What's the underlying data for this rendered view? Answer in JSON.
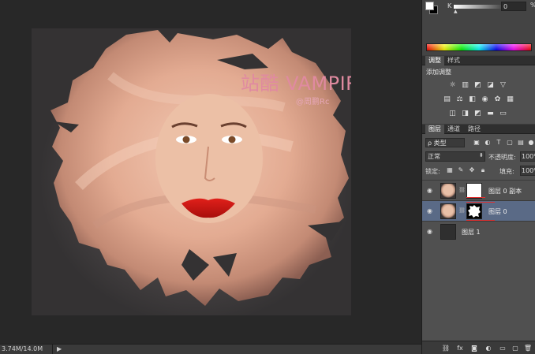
{
  "canvas": {
    "title_text": "站酷 VAMPIREE",
    "credit_text": "@周鹏Rc"
  },
  "status_bar": {
    "doc_size": "3.74M/14.0M",
    "arrow": "▶"
  },
  "color_panel": {
    "channel_label": "K",
    "channel_value": "0",
    "unit": "%",
    "foreground_color": "#ffffff",
    "background_color": "#000000",
    "thumb_glyph": "▲"
  },
  "adjustments_panel": {
    "tabs": [
      "调整",
      "样式"
    ],
    "hint": "添加调整",
    "icons": [
      "brightness-icon",
      "levels-icon",
      "curves-icon",
      "exposure-icon",
      "vibrance-icon",
      "hue-sat-icon",
      "color-balance-icon",
      "black-white-icon",
      "photo-filter-icon",
      "channel-mixer-icon",
      "color-lookup-icon",
      "invert-icon",
      "posterize-icon",
      "threshold-icon",
      "gradient-map-icon",
      "selective-color-icon"
    ]
  },
  "layers_panel": {
    "tabs": [
      "图层",
      "通道",
      "路径"
    ],
    "filter": "ρ 类型",
    "blend_mode": "正常",
    "opacity_label": "不透明度:",
    "opacity_value": "100%",
    "lock_label": "锁定:",
    "fill_label": "填充:",
    "fill_value": "100%",
    "layers": [
      {
        "name": "图层 0 副本",
        "visible": true,
        "selected": false,
        "thumb": "face",
        "mask": "white"
      },
      {
        "name": "图层 0",
        "visible": true,
        "selected": true,
        "thumb": "face",
        "mask": "splat"
      },
      {
        "name": "图层 1",
        "visible": true,
        "selected": false,
        "thumb": "dark",
        "mask": ""
      }
    ],
    "footer_icons": [
      "link-layers-icon",
      "fx-icon",
      "add-mask-icon",
      "adjustment-layer-icon",
      "group-icon",
      "new-layer-icon",
      "delete-layer-icon"
    ]
  },
  "colors": {
    "title_pink": "#e08aa0",
    "selected_row": "#5a6a86"
  }
}
